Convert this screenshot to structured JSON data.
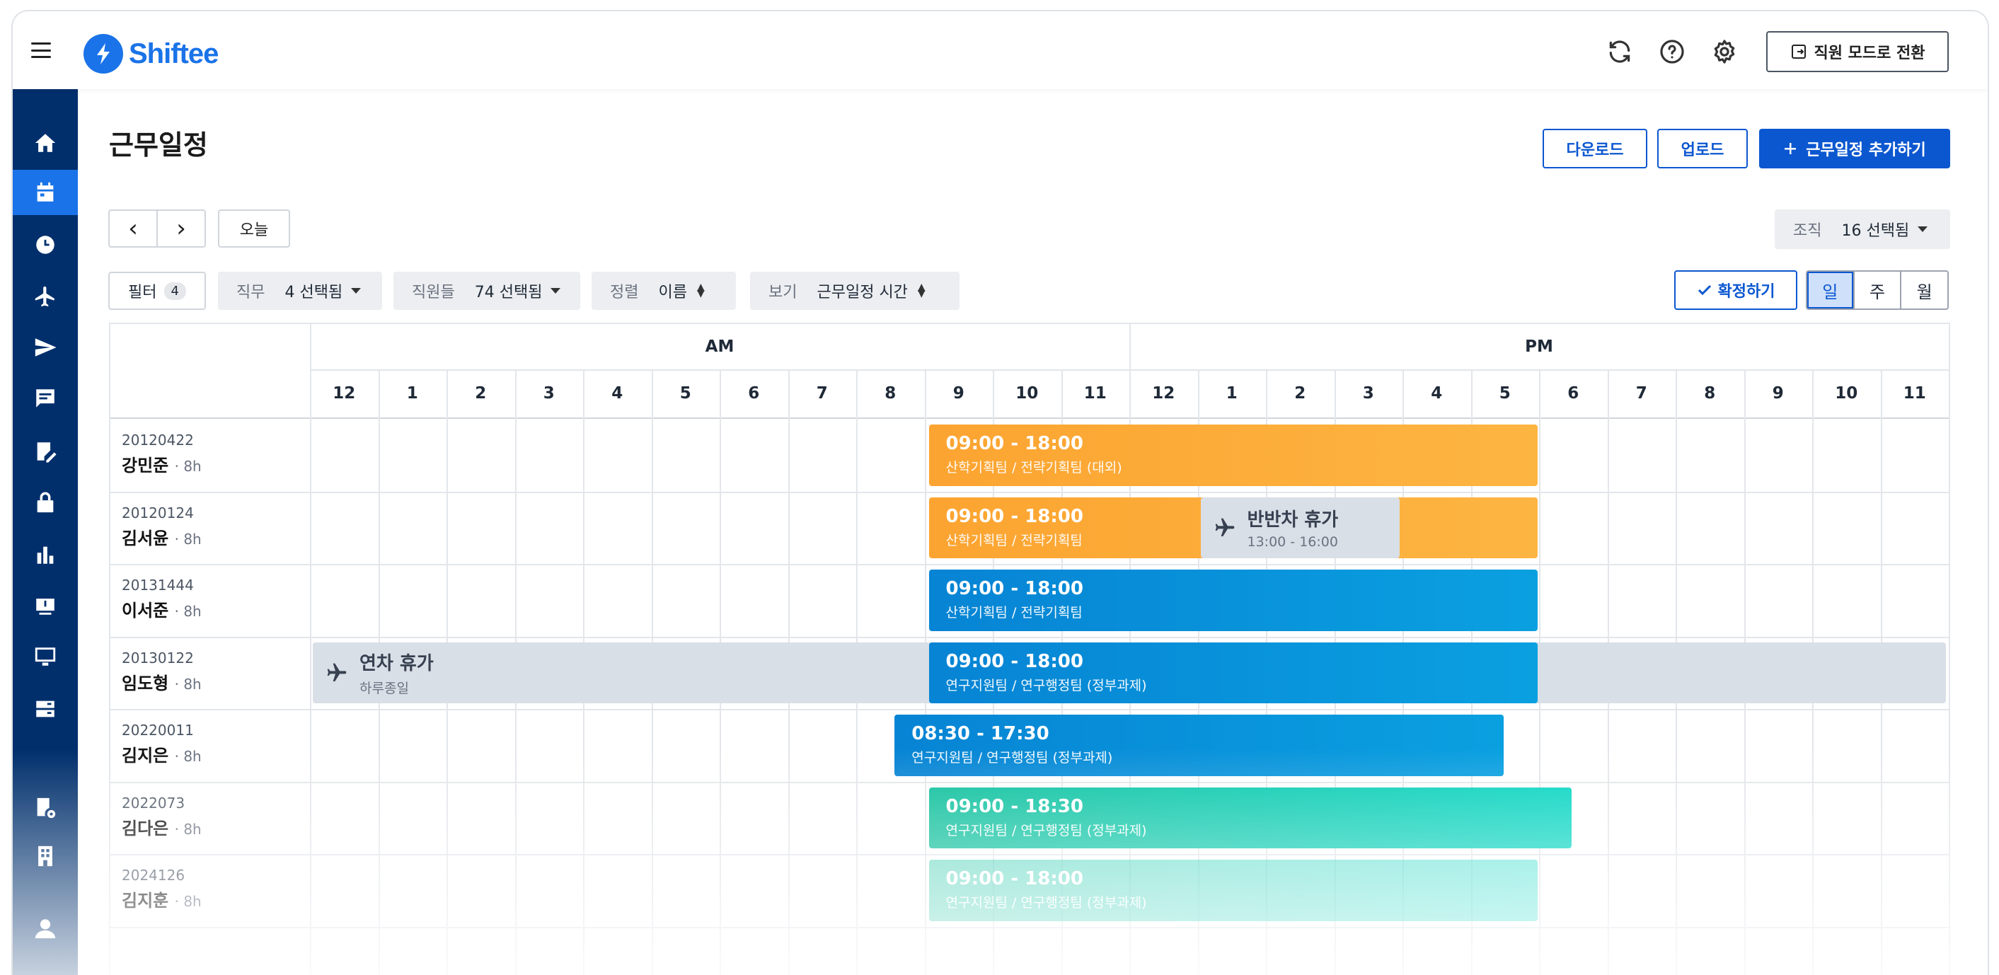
{
  "app": {
    "name": "Shiftee",
    "employee_mode": "직원 모드로 전환"
  },
  "page": {
    "title": "근무일정",
    "download": "다운로드",
    "upload": "업로드",
    "add_schedule": "근무일정 추가하기"
  },
  "nav": {
    "prev": "‹",
    "next": "›",
    "today": "오늘"
  },
  "org": {
    "label": "조직",
    "value": "16 선택됨"
  },
  "filters": {
    "filter_label": "필터",
    "filter_count": "4",
    "role": {
      "label": "직무",
      "value": "4 선택됨"
    },
    "staff": {
      "label": "직원들",
      "value": "74 선택됨"
    },
    "sort": {
      "label": "정렬",
      "value": "이름"
    },
    "view": {
      "label": "보기",
      "value": "근무일정 시간"
    }
  },
  "confirm": "확정하기",
  "view_modes": [
    "일",
    "주",
    "월"
  ],
  "grid": {
    "am": "AM",
    "pm": "PM",
    "hours": [
      "12",
      "1",
      "2",
      "3",
      "4",
      "5",
      "6",
      "7",
      "8",
      "9",
      "10",
      "11",
      "12",
      "1",
      "2",
      "3",
      "4",
      "5",
      "6",
      "7",
      "8",
      "9",
      "10",
      "11"
    ]
  },
  "employees": [
    {
      "id": "20120422",
      "name": "강민준",
      "hours": "· 8h"
    },
    {
      "id": "20120124",
      "name": "김서윤",
      "hours": "· 8h"
    },
    {
      "id": "20131444",
      "name": "이서준",
      "hours": "· 8h"
    },
    {
      "id": "20130122",
      "name": "임도형",
      "hours": "· 8h"
    },
    {
      "id": "20220011",
      "name": "김지은",
      "hours": "· 8h"
    },
    {
      "id": "2022073",
      "name": "김다은",
      "hours": "· 8h"
    },
    {
      "id": "2024126",
      "name": "김지훈",
      "hours": "· 8h"
    }
  ],
  "shifts": [
    {
      "row": 0,
      "start": 9,
      "end": 18,
      "time": "09:00 - 18:00",
      "team": "산학기획팀 / 전략기획팀 (대외)",
      "color": "orange"
    },
    {
      "row": 1,
      "start": 9,
      "end": 18,
      "time": "09:00 - 18:00",
      "team": "산학기획팀 / 전략기획팀",
      "color": "orange"
    },
    {
      "row": 2,
      "start": 9,
      "end": 18,
      "time": "09:00 - 18:00",
      "team": "산학기획팀 / 전략기획팀",
      "color": "blue"
    },
    {
      "row": 3,
      "start": 9,
      "end": 18,
      "time": "09:00 - 18:00",
      "team": "연구지원팀 / 연구행정팀 (정부과제)",
      "color": "blue"
    },
    {
      "row": 4,
      "start": 8.5,
      "end": 17.5,
      "time": "08:30 - 17:30",
      "team": "연구지원팀 / 연구행정팀 (정부과제)",
      "color": "blue"
    },
    {
      "row": 5,
      "start": 9,
      "end": 18.5,
      "time": "09:00 - 18:30",
      "team": "연구지원팀 / 연구행정팀 (정부과제)",
      "color": "green"
    },
    {
      "row": 6,
      "start": 9,
      "end": 18,
      "time": "09:00 - 18:00",
      "team": "연구지원팀 / 연구행정팀 (정부과제)",
      "color": "green"
    }
  ],
  "leaves": [
    {
      "row": 1,
      "start": 13,
      "end": 16,
      "title": "반반차 휴가",
      "sub": "13:00 - 16:00"
    },
    {
      "row": 3,
      "start": 0,
      "end": 24,
      "title": "연차 휴가",
      "sub": "하루종일"
    }
  ]
}
